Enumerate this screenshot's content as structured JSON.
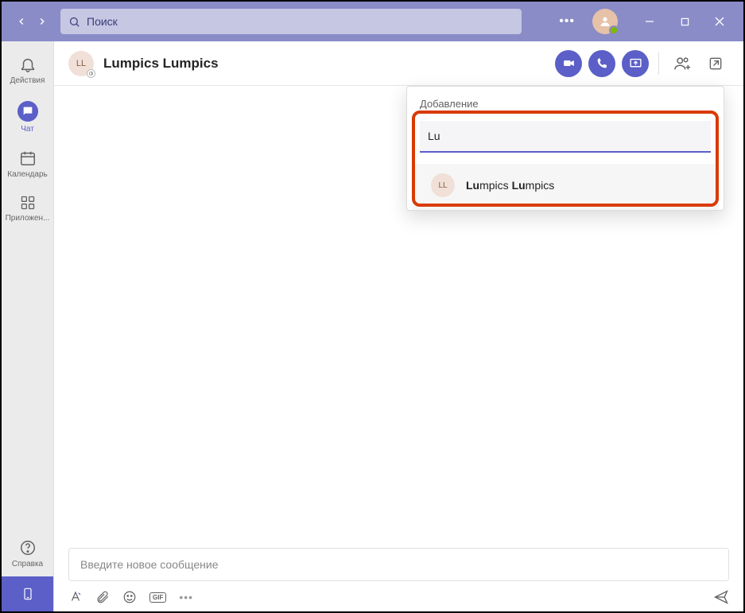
{
  "titlebar": {
    "search_placeholder": "Поиск"
  },
  "rail": {
    "items": [
      {
        "label": "Действия"
      },
      {
        "label": "Чат"
      },
      {
        "label": "Календарь"
      },
      {
        "label": "Приложен..."
      }
    ],
    "help_label": "Справка"
  },
  "chat": {
    "avatar_initials": "LL",
    "title": "Lumpics Lumpics"
  },
  "popover": {
    "title": "Добавление",
    "input_value": "Lu",
    "result": {
      "avatar_initials": "LL",
      "name_bold1": "Lu",
      "name_rest1": "mpics ",
      "name_bold2": "Lu",
      "name_rest2": "mpics"
    }
  },
  "composer": {
    "placeholder": "Введите новое сообщение",
    "gif_label": "GIF"
  }
}
